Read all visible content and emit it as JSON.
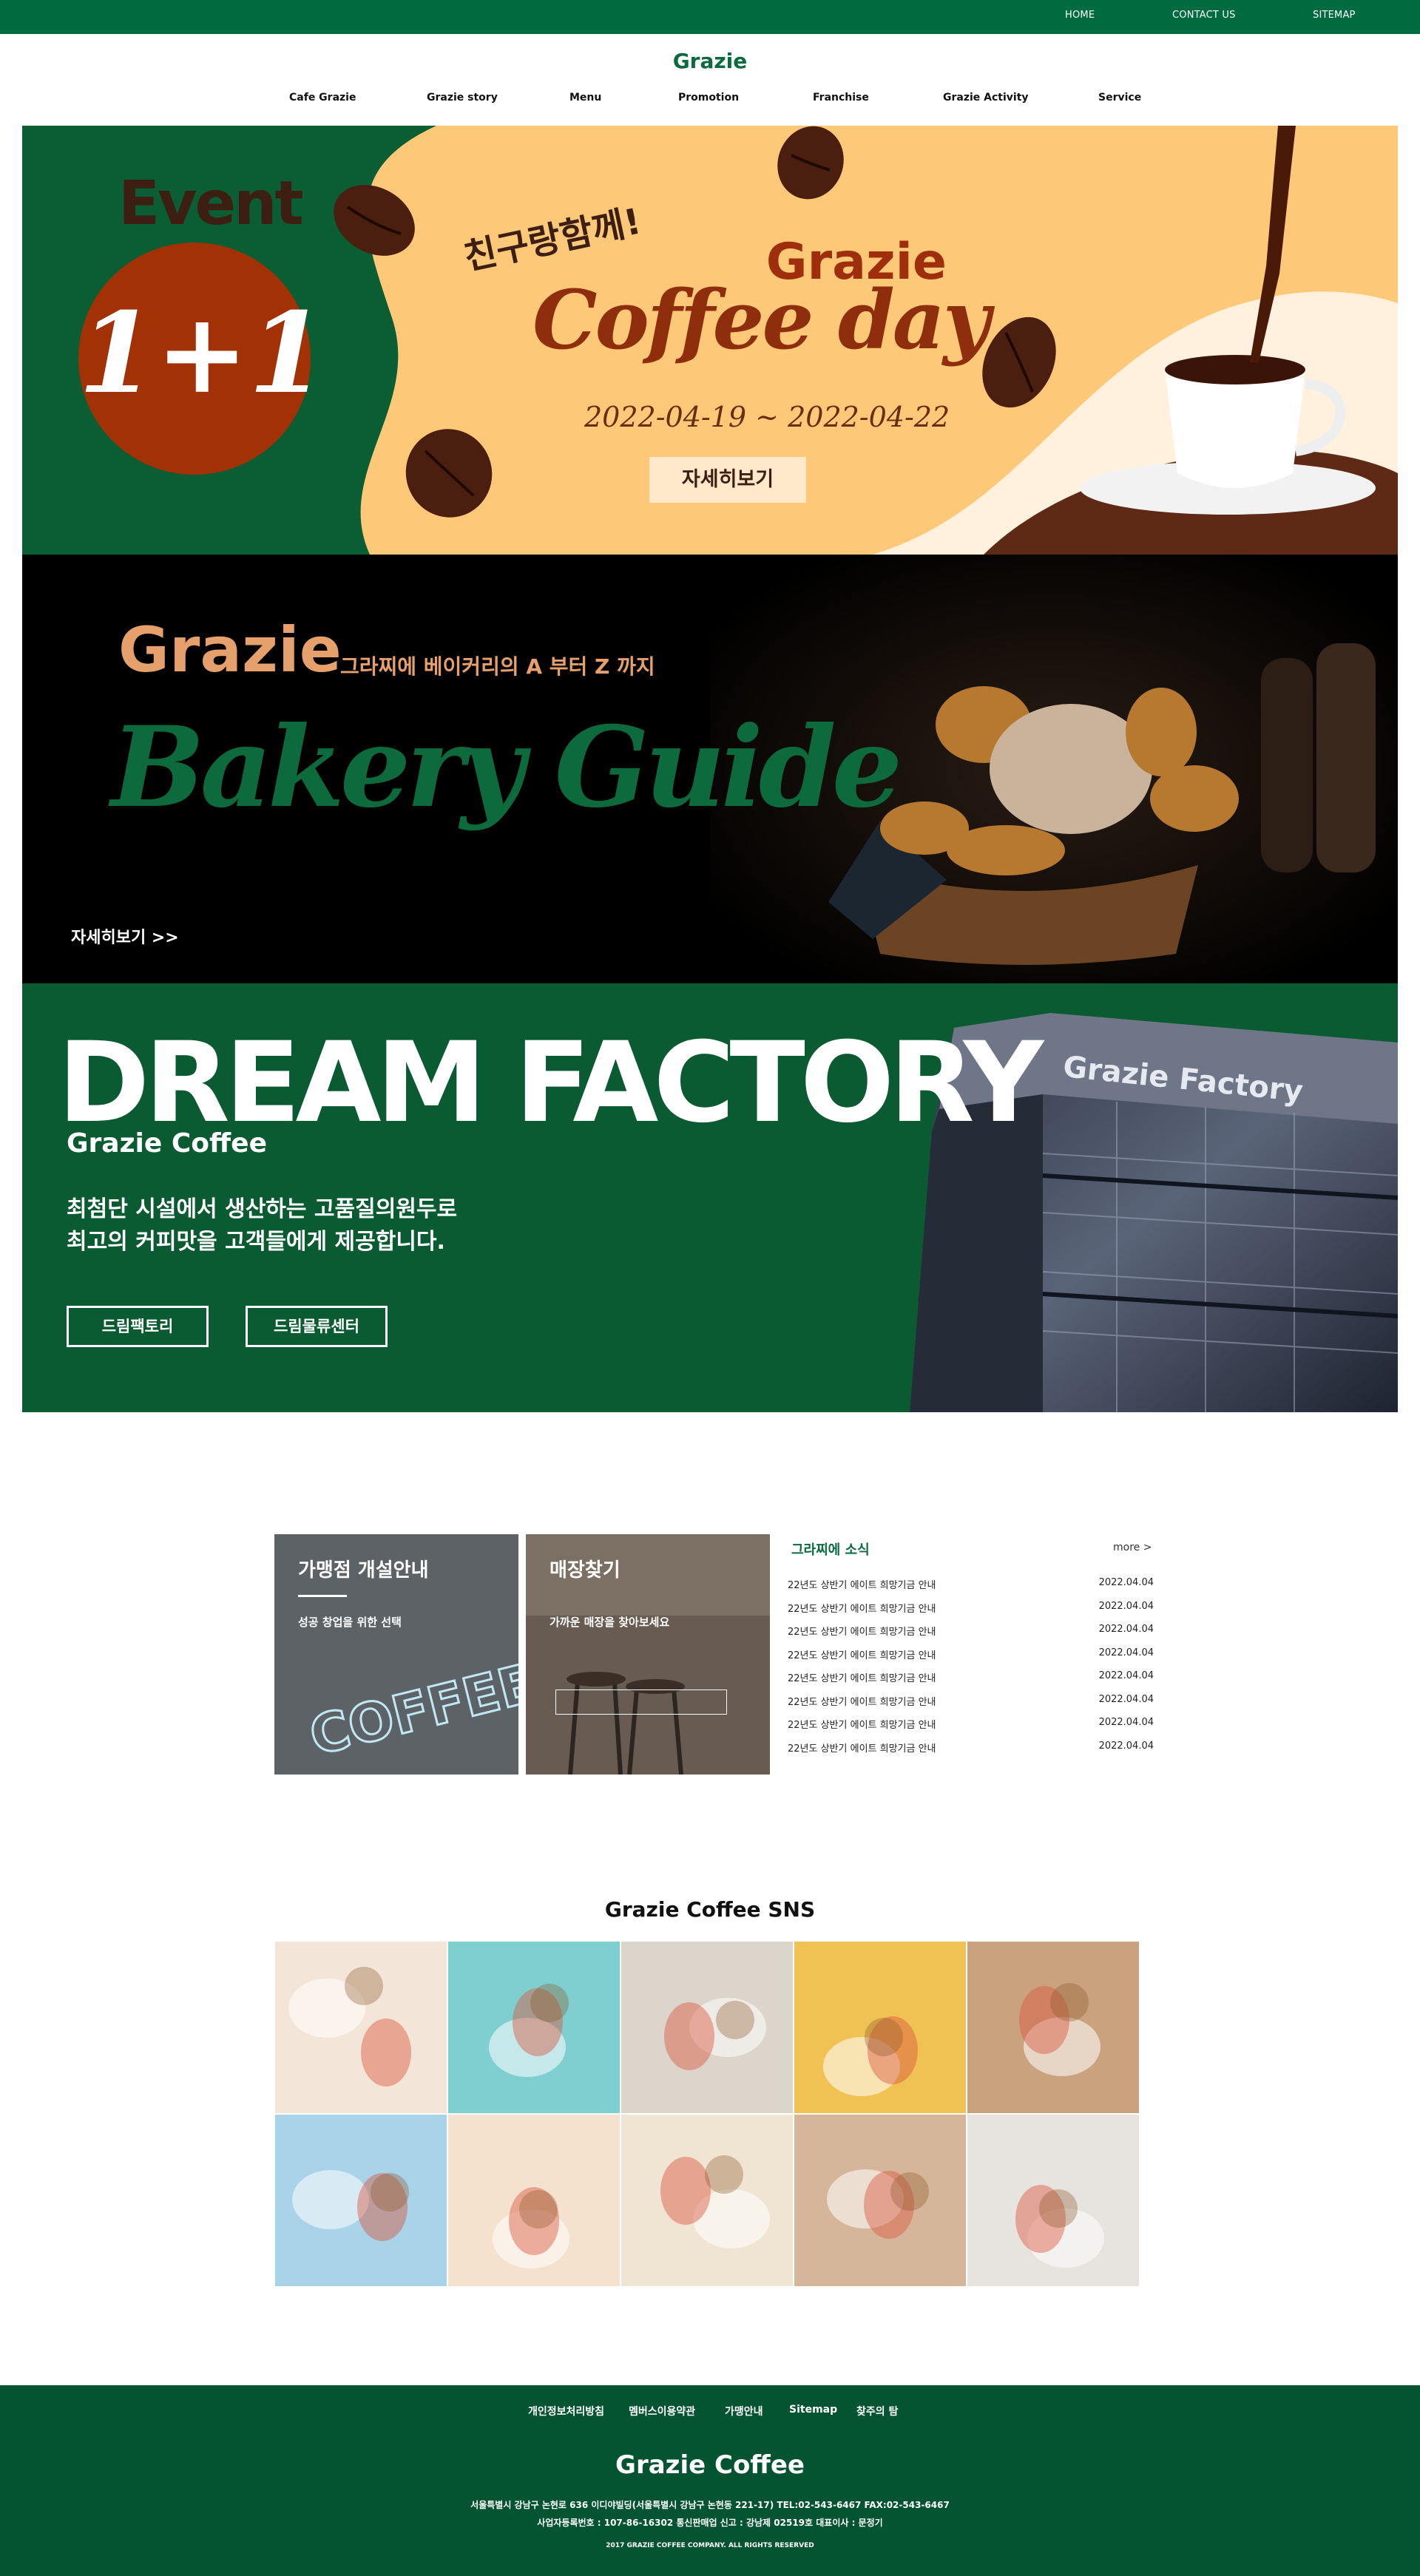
{
  "topbar": {
    "home": "HOME",
    "contact": "CONTACT US",
    "sitemap": "SITEMAP"
  },
  "header": {
    "logo": "Grazie",
    "nav": [
      "Cafe Grazie",
      "Grazie story",
      "Menu",
      "Promotion",
      "Franchise",
      "Grazie Activity",
      "Service"
    ]
  },
  "banner_event": {
    "event_word": "Event",
    "badge": "1+1",
    "tagline": "친구랑함께!",
    "brand": "Grazie",
    "script": "Coffee day",
    "date": "2022-04-19 ~ 2022-04-22",
    "button": "자세히보기"
  },
  "banner_bakery": {
    "brand": "Grazie",
    "sub": "그라찌에 베이커리의 A 부터 Z 까지",
    "script": "Bakery Guide",
    "link": "자세히보기 >>"
  },
  "banner_factory": {
    "title": "DREAM FACTORY",
    "sub": "Grazie Coffee",
    "desc_line1": "최첨단 시설에서 생산하는 고품질의원두로",
    "desc_line2": "최고의 커피맛을 고객들에게 제공합니다.",
    "button1": "드림팩토리",
    "button2": "드림물류센터",
    "sign": "Grazie Factory"
  },
  "cards": {
    "franchise": {
      "title": "가맹점 개설안내",
      "sub": "성공 창업을 위한 선택",
      "neon": "COFFEE"
    },
    "stores": {
      "title": "매장찾기",
      "sub": "가까운 매장을 찾아보세요"
    }
  },
  "news": {
    "heading": "그라찌에 소식",
    "more": "more >",
    "items": [
      {
        "title": "22년도 상반기 에이트 희망기금 안내",
        "date": "2022.04.04"
      },
      {
        "title": "22년도 상반기 에이트 희망기금 안내",
        "date": "2022.04.04"
      },
      {
        "title": "22년도 상반기 에이트 희망기금 안내",
        "date": "2022.04.04"
      },
      {
        "title": "22년도 상반기 에이트 희망기금 안내",
        "date": "2022.04.04"
      },
      {
        "title": "22년도 상반기 에이트 희망기금 안내",
        "date": "2022.04.04"
      },
      {
        "title": "22년도 상반기 에이트 희망기금 안내",
        "date": "2022.04.04"
      },
      {
        "title": "22년도 상반기 에이트 희망기금 안내",
        "date": "2022.04.04"
      },
      {
        "title": "22년도 상반기 에이트 희망기금 안내",
        "date": "2022.04.04"
      }
    ]
  },
  "sns": {
    "title": "Grazie Coffee SNS",
    "tiles": [
      "#f3e6d8",
      "#7fcfd0",
      "#dcd5cb",
      "#f0c254",
      "#caa27e",
      "#a8d3e8",
      "#f4e2cf",
      "#f0e4d3",
      "#d6b69a",
      "#e7e3df"
    ]
  },
  "footer": {
    "links": [
      "개인정보처리방침",
      "멤버스이용약관",
      "가맹안내",
      "Sitemap",
      "찾주의 탐"
    ],
    "brand": "Grazie Coffee",
    "address": "서울특별시 강남구 논현로 636 이디야빌딩(서울특별시 강남구 논현동 221-17)      TEL:02-543-6467      FAX:02-543-6467",
    "business": "사업자등록번호 : 107-86-16302      통신판매업 신고 : 강남제 02519호      대표이사 : 문정기",
    "copyright": "2017 GRAZIE COFFEE COMPANY. ALL RIGHTS RESERVED"
  },
  "colors": {
    "brand_green": "#006b3f",
    "event_yellow": "#fdc978",
    "coffee_brown": "#8f2e0c",
    "footer_green": "#045431"
  }
}
